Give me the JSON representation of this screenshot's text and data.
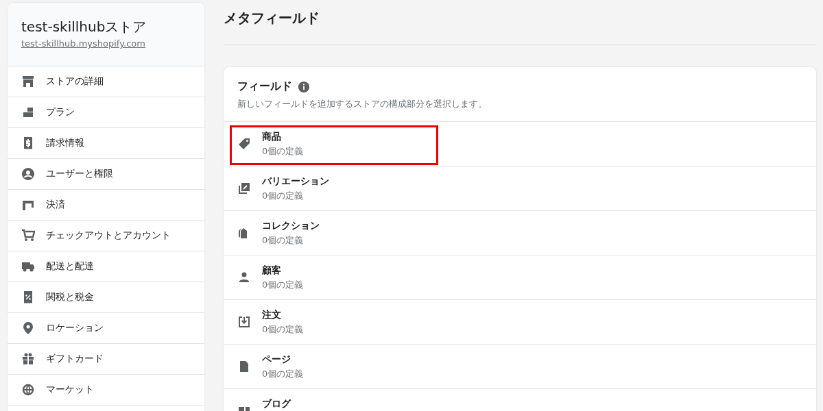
{
  "sidebar": {
    "store_name": "test-skillhubストア",
    "store_url": "test-skillhub.myshopify.com",
    "items": [
      {
        "label": "ストアの詳細"
      },
      {
        "label": "プラン"
      },
      {
        "label": "請求情報"
      },
      {
        "label": "ユーザーと権限"
      },
      {
        "label": "決済"
      },
      {
        "label": "チェックアウトとアカウント"
      },
      {
        "label": "配送と配達"
      },
      {
        "label": "関税と税金"
      },
      {
        "label": "ロケーション"
      },
      {
        "label": "ギフトカード"
      },
      {
        "label": "マーケット"
      }
    ]
  },
  "page_title": "メタフィールド",
  "card": {
    "title": "フィールド",
    "description": "新しいフィールドを追加するストアの構成部分を選択します。",
    "rows": [
      {
        "name": "商品",
        "count": "0個の定義",
        "highlighted": true
      },
      {
        "name": "バリエーション",
        "count": "0個の定義",
        "highlighted": false
      },
      {
        "name": "コレクション",
        "count": "0個の定義",
        "highlighted": false
      },
      {
        "name": "顧客",
        "count": "0個の定義",
        "highlighted": false
      },
      {
        "name": "注文",
        "count": "0個の定義",
        "highlighted": false
      },
      {
        "name": "ページ",
        "count": "0個の定義",
        "highlighted": false
      },
      {
        "name": "ブログ",
        "highlighted": false
      }
    ]
  }
}
